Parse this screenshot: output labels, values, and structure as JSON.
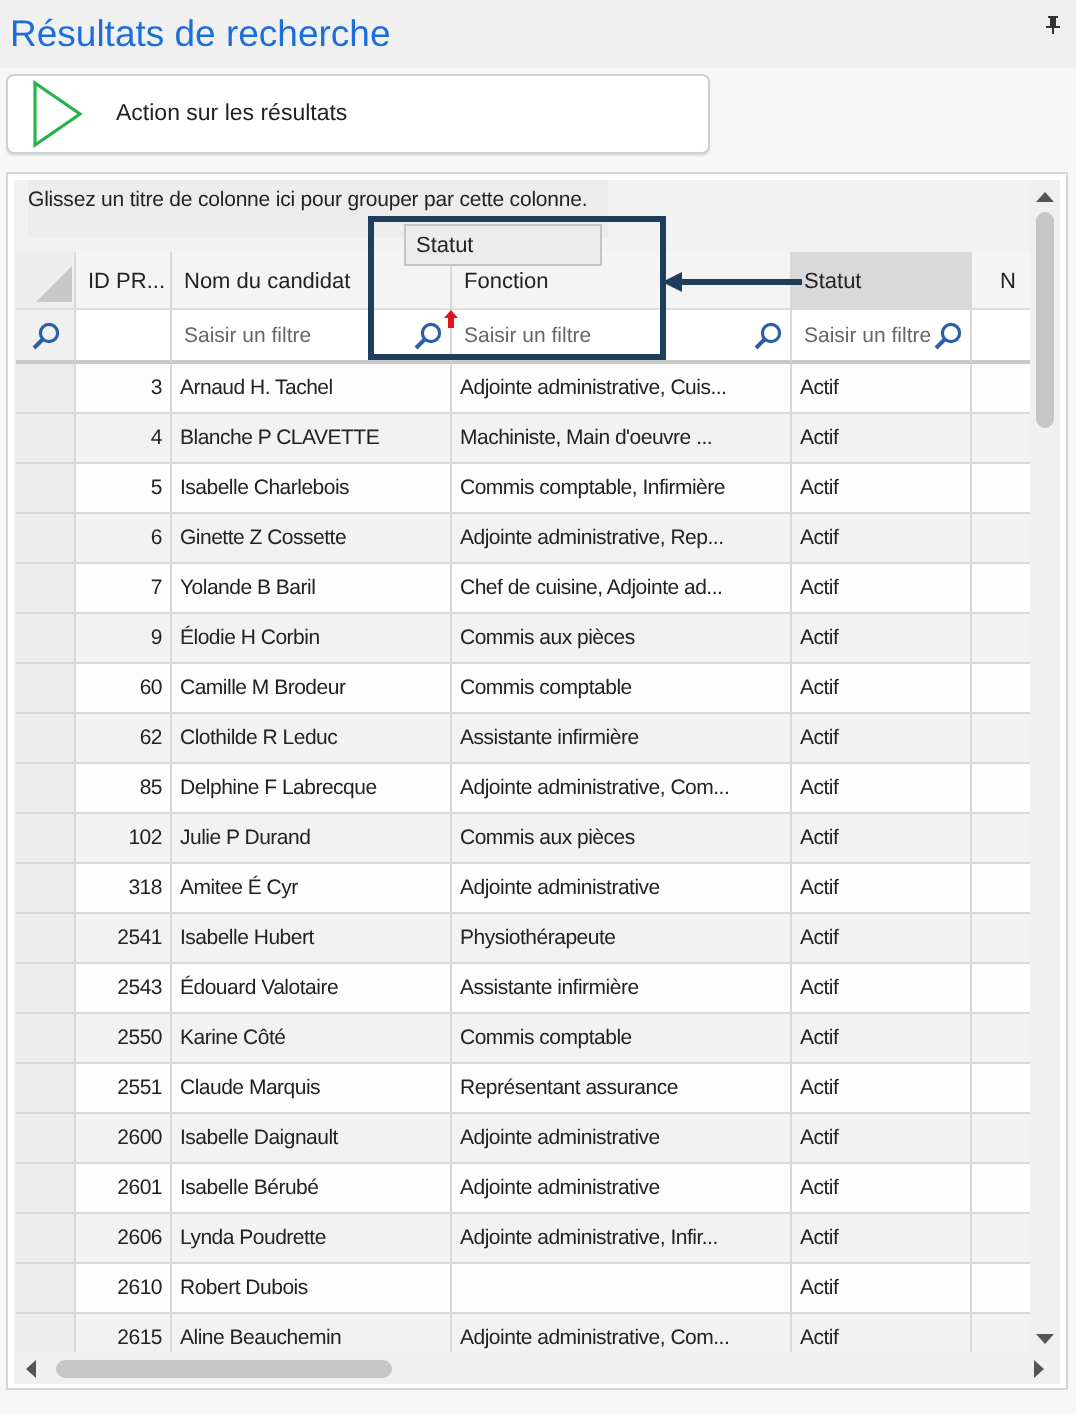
{
  "panel": {
    "title": "Résultats de recherche"
  },
  "action_button": {
    "label": "Action sur les résultats"
  },
  "group_panel": {
    "hint": "Glissez un titre de colonne ici pour grouper par cette colonne."
  },
  "drag_ghost": {
    "label": "Statut"
  },
  "table": {
    "columns": [
      {
        "label": "ID PR...",
        "sorted": false
      },
      {
        "label": "Nom du candidat",
        "sorted": false,
        "filter_placeholder": "Saisir un filtre"
      },
      {
        "label": "Fonction",
        "sorted": false,
        "filter_placeholder": "Saisir un filtre"
      },
      {
        "label": "Statut",
        "sorted": true,
        "filter_placeholder": "Saisir un filtre"
      },
      {
        "label": "N",
        "sorted": false
      }
    ],
    "rows": [
      {
        "id": "3",
        "name": "Arnaud H. Tachel",
        "function": "Adjointe administrative, Cuis...",
        "status": "Actif"
      },
      {
        "id": "4",
        "name": "Blanche P CLAVETTE",
        "function": "Machiniste, Main d'oeuvre ...",
        "status": "Actif"
      },
      {
        "id": "5",
        "name": "Isabelle Charlebois",
        "function": "Commis comptable, Infirmière",
        "status": "Actif"
      },
      {
        "id": "6",
        "name": "Ginette Z Cossette",
        "function": "Adjointe administrative, Rep...",
        "status": "Actif"
      },
      {
        "id": "7",
        "name": "Yolande B Baril",
        "function": "Chef de cuisine, Adjointe ad...",
        "status": "Actif"
      },
      {
        "id": "9",
        "name": "Élodie H Corbin",
        "function": "Commis aux pièces",
        "status": "Actif"
      },
      {
        "id": "60",
        "name": "Camille M Brodeur",
        "function": "Commis comptable",
        "status": "Actif"
      },
      {
        "id": "62",
        "name": "Clothilde R Leduc",
        "function": "Assistante infirmière",
        "status": "Actif"
      },
      {
        "id": "85",
        "name": "Delphine F Labrecque",
        "function": "Adjointe administrative, Com...",
        "status": "Actif"
      },
      {
        "id": "102",
        "name": "Julie P Durand",
        "function": "Commis aux pièces",
        "status": "Actif"
      },
      {
        "id": "318",
        "name": "Amitee É Cyr",
        "function": "Adjointe administrative",
        "status": "Actif"
      },
      {
        "id": "2541",
        "name": "Isabelle Hubert",
        "function": "Physiothérapeute",
        "status": "Actif"
      },
      {
        "id": "2543",
        "name": "Édouard Valotaire",
        "function": "Assistante infirmière",
        "status": "Actif"
      },
      {
        "id": "2550",
        "name": "Karine Côté",
        "function": "Commis comptable",
        "status": "Actif"
      },
      {
        "id": "2551",
        "name": "Claude Marquis",
        "function": "Représentant assurance",
        "status": "Actif"
      },
      {
        "id": "2600",
        "name": "Isabelle Daignault",
        "function": "Adjointe administrative",
        "status": "Actif"
      },
      {
        "id": "2601",
        "name": "Isabelle Bérubé",
        "function": "Adjointe administrative",
        "status": "Actif"
      },
      {
        "id": "2606",
        "name": "Lynda Poudrette",
        "function": "Adjointe administrative, Infir...",
        "status": "Actif"
      },
      {
        "id": "2610",
        "name": "Robert Dubois",
        "status": "Actif"
      },
      {
        "id": "2615",
        "name": "Aline Beauchemin",
        "function": "Adjointe administrative, Com...",
        "status": "Actif"
      }
    ]
  }
}
